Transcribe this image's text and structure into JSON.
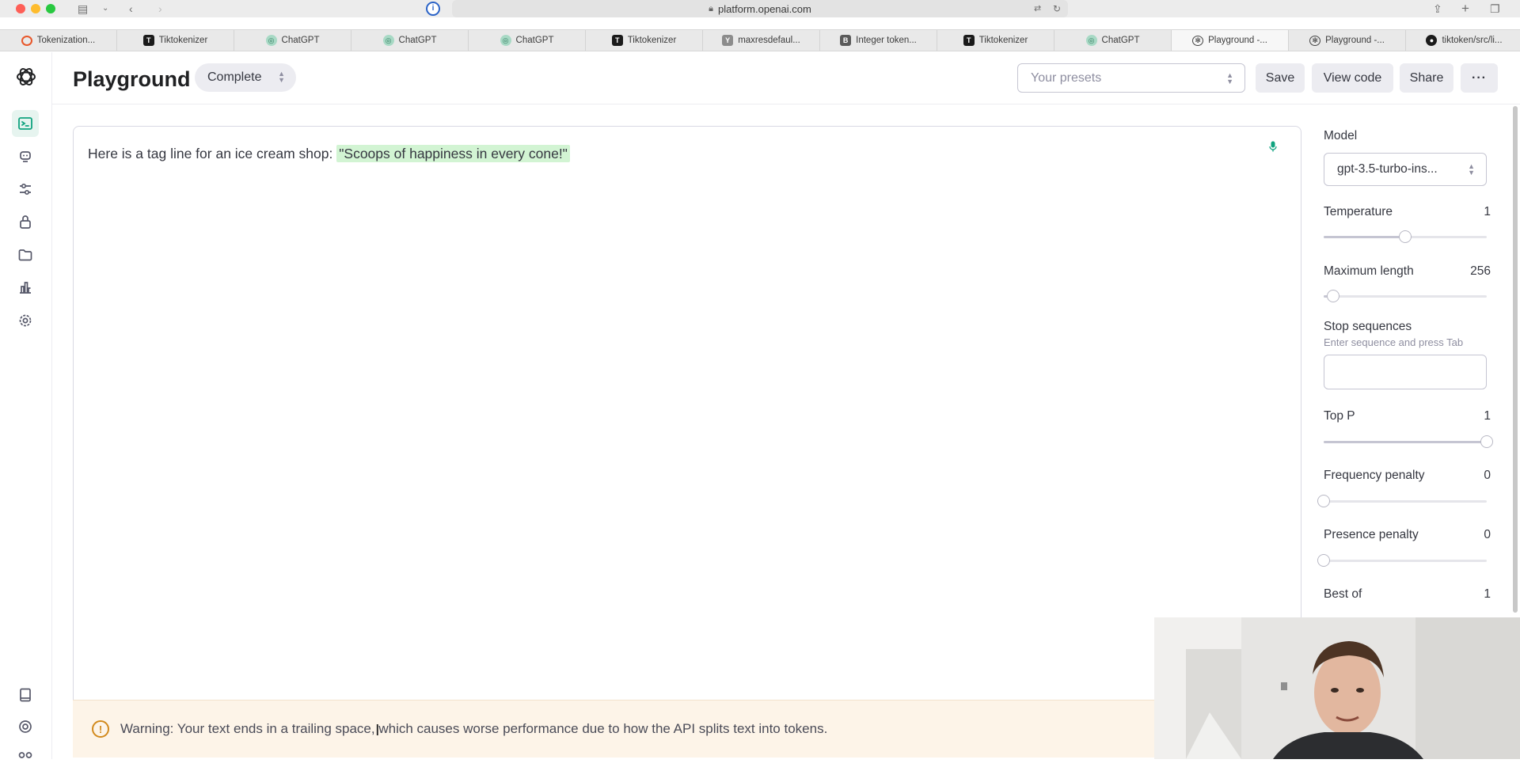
{
  "browser": {
    "url": "platform.openai.com",
    "tabs": [
      {
        "title": "Tokenization...",
        "favicon": "tokenization-icon",
        "active": false
      },
      {
        "title": "Tiktokenizer",
        "favicon": "tiktokenizer-icon",
        "active": false
      },
      {
        "title": "ChatGPT",
        "favicon": "chatgpt-icon",
        "active": false
      },
      {
        "title": "ChatGPT",
        "favicon": "chatgpt-icon",
        "active": false
      },
      {
        "title": "ChatGPT",
        "favicon": "chatgpt-icon",
        "active": false
      },
      {
        "title": "Tiktokenizer",
        "favicon": "tiktokenizer-icon",
        "active": false
      },
      {
        "title": "maxresdefaul...",
        "favicon": "y-icon",
        "active": false
      },
      {
        "title": "Integer token...",
        "favicon": "b-icon",
        "active": false
      },
      {
        "title": "Tiktokenizer",
        "favicon": "tiktokenizer-icon",
        "active": false
      },
      {
        "title": "ChatGPT",
        "favicon": "chatgpt-icon",
        "active": false
      },
      {
        "title": "Playground -...",
        "favicon": "openai-icon",
        "active": true
      },
      {
        "title": "Playground -...",
        "favicon": "openai-icon",
        "active": false
      },
      {
        "title": "tiktoken/src/li...",
        "favicon": "github-icon",
        "active": false
      }
    ]
  },
  "header": {
    "title": "Playground",
    "mode": "Complete",
    "presets_placeholder": "Your presets",
    "save_label": "Save",
    "view_code_label": "View code",
    "share_label": "Share",
    "more_label": "···"
  },
  "editor": {
    "prompt": "Here is a tag line for an ice cream shop: ",
    "completion": "\"Scoops of happiness in every cone!\""
  },
  "warning": {
    "text": "Warning: Your text ends in a trailing space, which causes worse performance due to how the API splits text into tokens."
  },
  "settings": {
    "model_label": "Model",
    "model_value": "gpt-3.5-turbo-ins...",
    "temperature_label": "Temperature",
    "temperature_value": "1",
    "temperature_level": 0.5,
    "max_length_label": "Maximum length",
    "max_length_value": "256",
    "max_length_level": 0.06,
    "stop_label": "Stop sequences",
    "stop_hint": "Enter sequence and press Tab",
    "top_p_label": "Top P",
    "top_p_value": "1",
    "top_p_level": 1.0,
    "freq_label": "Frequency penalty",
    "freq_value": "0",
    "freq_level": 0.0,
    "presence_label": "Presence penalty",
    "presence_value": "0",
    "presence_level": 0.0,
    "best_of_label": "Best of",
    "best_of_value": "1"
  },
  "colors": {
    "accent": "#10a37f",
    "completion_highlight": "#d2f4d3",
    "warning_bg": "#fdf4e8",
    "warning_icon": "#d28a1d"
  }
}
